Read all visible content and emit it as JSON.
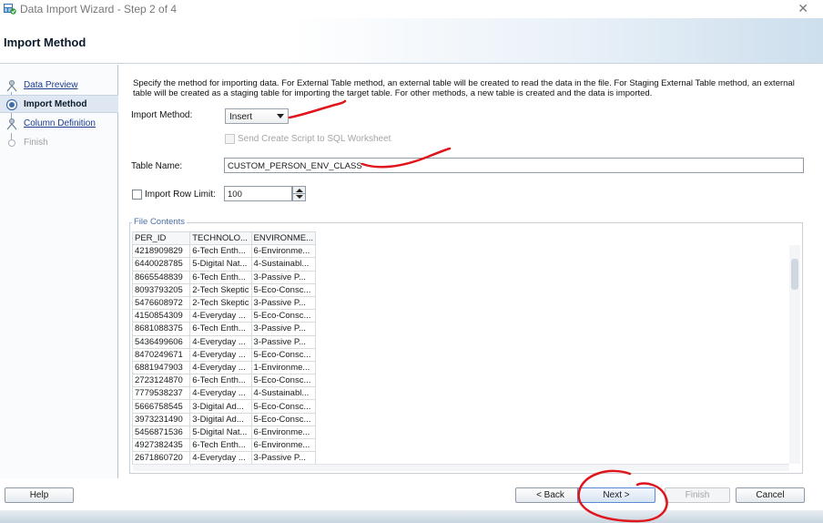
{
  "window": {
    "title": "Data Import Wizard - Step 2 of 4",
    "close_icon": "close-icon"
  },
  "header": {
    "title": "Import Method"
  },
  "nav": {
    "items": [
      {
        "label": "Data Preview",
        "state": "link"
      },
      {
        "label": "Import Method",
        "state": "current"
      },
      {
        "label": "Column Definition",
        "state": "link"
      },
      {
        "label": "Finish",
        "state": "disabled"
      }
    ]
  },
  "main": {
    "description": "Specify the method for importing data.  For External Table method, an external table will be created to read the data in the file.  For Staging External Table method, an external table will be created as a staging table for importing the target table.  For other methods, a new table is created and the data is imported.",
    "import_method": {
      "label": "Import Method:",
      "value": "Insert"
    },
    "send_script": {
      "label": "Send Create Script to SQL Worksheet",
      "checked": false,
      "enabled": false
    },
    "table_name": {
      "label": "Table Name:",
      "value": "CUSTOM_PERSON_ENV_CLASS"
    },
    "row_limit": {
      "label": "Import Row Limit:",
      "value": "100",
      "checked": false
    },
    "file_contents": {
      "legend": "File Contents",
      "columns": [
        "PER_ID",
        "TECHNOLO...",
        "ENVIRONME..."
      ],
      "rows": [
        [
          "4218909829",
          "6-Tech Enth...",
          "6-Environme..."
        ],
        [
          "6440028785",
          "5-Digital Nat...",
          "4-Sustainabl..."
        ],
        [
          "8665548839",
          "6-Tech Enth...",
          "3-Passive P..."
        ],
        [
          "8093793205",
          "2-Tech Skeptic",
          "5-Eco-Consc..."
        ],
        [
          "5476608972",
          "2-Tech Skeptic",
          "3-Passive P..."
        ],
        [
          "4150854309",
          "4-Everyday ...",
          "5-Eco-Consc..."
        ],
        [
          "8681088375",
          "6-Tech Enth...",
          "3-Passive P..."
        ],
        [
          "5436499606",
          "4-Everyday ...",
          "3-Passive P..."
        ],
        [
          "8470249671",
          "4-Everyday ...",
          "5-Eco-Consc..."
        ],
        [
          "6881947903",
          "4-Everyday ...",
          "1-Environme..."
        ],
        [
          "2723124870",
          "6-Tech Enth...",
          "5-Eco-Consc..."
        ],
        [
          "7779538237",
          "4-Everyday ...",
          "4-Sustainabl..."
        ],
        [
          "5666758545",
          "3-Digital Ad...",
          "5-Eco-Consc..."
        ],
        [
          "3973231490",
          "3-Digital Ad...",
          "5-Eco-Consc..."
        ],
        [
          "5456871536",
          "5-Digital Nat...",
          "6-Environme..."
        ],
        [
          "4927382435",
          "6-Tech Enth...",
          "6-Environme..."
        ],
        [
          "2671860720",
          "4-Everyday ...",
          "3-Passive P..."
        ]
      ]
    }
  },
  "footer": {
    "help": "Help",
    "back": "< Back",
    "next": "Next >",
    "finish": "Finish",
    "cancel": "Cancel"
  },
  "colors": {
    "annotation": "#e0141b",
    "link": "#1b3d8f",
    "current_bg": "#dfe8f2"
  }
}
